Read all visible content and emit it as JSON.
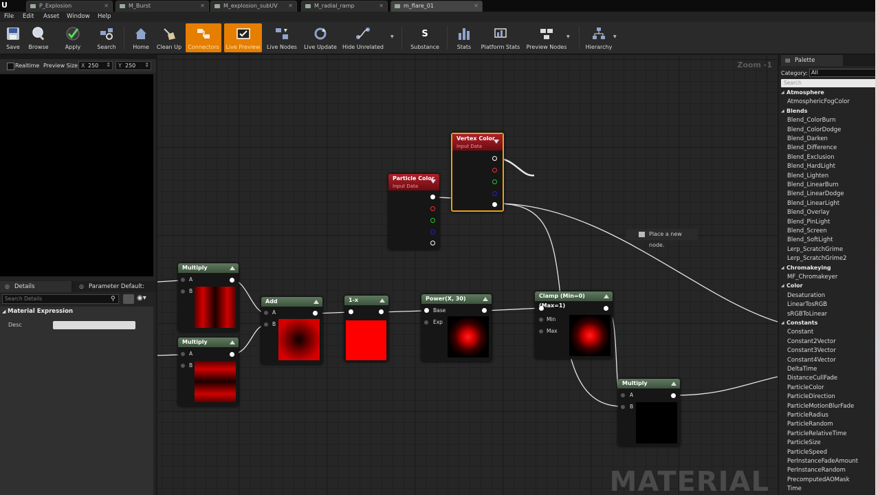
{
  "tabs": [
    {
      "label": "P_Explosion",
      "active": false
    },
    {
      "label": "M_Burst",
      "active": false
    },
    {
      "label": "M_explosion_subUV",
      "active": false
    },
    {
      "label": "M_radial_ramp",
      "active": false
    },
    {
      "label": "m_flare_01",
      "active": true
    }
  ],
  "menu": [
    "File",
    "Edit",
    "Asset",
    "Window",
    "Help"
  ],
  "toolbar": {
    "save": "Save",
    "browse": "Browse",
    "apply": "Apply",
    "search": "Search",
    "home": "Home",
    "cleanup": "Clean Up",
    "connectors": "Connectors",
    "live_preview": "Live Preview",
    "live_nodes": "Live Nodes",
    "live_update": "Live Update",
    "hide_unrelated": "Hide Unrelated",
    "substance": "Substance",
    "stats": "Stats",
    "platform_stats": "Platform Stats",
    "preview_nodes": "Preview Nodes",
    "hierarchy": "Hierarchy"
  },
  "preview": {
    "realtime": "Realtime",
    "preview_size": "Preview Size",
    "x_label": "X",
    "x_value": "250",
    "y_label": "Y",
    "y_value": "250"
  },
  "details": {
    "tab_details": "Details",
    "tab_params": "Parameter Default:",
    "search_placeholder": "Search Details",
    "section": "Material Expression",
    "desc_label": "Desc",
    "desc_value": ""
  },
  "graph": {
    "zoom": "Zoom -1",
    "watermark": "MATERIAL",
    "place_node": "Place a new node."
  },
  "nodes": {
    "vertex_color": {
      "title": "Vertex Color",
      "subtitle": "Input Data"
    },
    "particle_color": {
      "title": "Particle Color",
      "subtitle": "Input Data"
    },
    "multiply1": {
      "title": "Multiply",
      "a": "A",
      "b": "B"
    },
    "multiply2": {
      "title": "Multiply",
      "a": "A",
      "b": "B"
    },
    "add": {
      "title": "Add",
      "a": "A",
      "b": "B"
    },
    "one_minus": {
      "title": "1-x"
    },
    "power": {
      "title": "Power(X, 30)",
      "base": "Base",
      "exp": "Exp"
    },
    "clamp": {
      "title": "Clamp (Min=0) (Max=1)",
      "min": "Min",
      "max": "Max"
    },
    "multiply3": {
      "title": "Multiply",
      "a": "A",
      "b": "B"
    }
  },
  "palette": {
    "title": "Palette",
    "category_label": "Category:",
    "category_value": "All",
    "search_placeholder": "Search",
    "entries": [
      {
        "type": "cat",
        "text": "Atmosphere"
      },
      {
        "type": "item",
        "text": "AtmosphericFogColor"
      },
      {
        "type": "cat",
        "text": "Blends"
      },
      {
        "type": "item",
        "text": "Blend_ColorBurn"
      },
      {
        "type": "item",
        "text": "Blend_ColorDodge"
      },
      {
        "type": "item",
        "text": "Blend_Darken"
      },
      {
        "type": "item",
        "text": "Blend_Difference"
      },
      {
        "type": "item",
        "text": "Blend_Exclusion"
      },
      {
        "type": "item",
        "text": "Blend_HardLight"
      },
      {
        "type": "item",
        "text": "Blend_Lighten"
      },
      {
        "type": "item",
        "text": "Blend_LinearBurn"
      },
      {
        "type": "item",
        "text": "Blend_LinearDodge"
      },
      {
        "type": "item",
        "text": "Blend_LinearLight"
      },
      {
        "type": "item",
        "text": "Blend_Overlay"
      },
      {
        "type": "item",
        "text": "Blend_PinLight"
      },
      {
        "type": "item",
        "text": "Blend_Screen"
      },
      {
        "type": "item",
        "text": "Blend_SoftLight"
      },
      {
        "type": "item",
        "text": "Lerp_ScratchGrime"
      },
      {
        "type": "item",
        "text": "Lerp_ScratchGrime2"
      },
      {
        "type": "cat",
        "text": "Chromakeying"
      },
      {
        "type": "item",
        "text": "MF_Chromakeyer"
      },
      {
        "type": "cat",
        "text": "Color"
      },
      {
        "type": "item",
        "text": "Desaturation"
      },
      {
        "type": "item",
        "text": "LinearTosRGB"
      },
      {
        "type": "item",
        "text": "sRGBToLinear"
      },
      {
        "type": "cat",
        "text": "Constants"
      },
      {
        "type": "item",
        "text": "Constant"
      },
      {
        "type": "item",
        "text": "Constant2Vector"
      },
      {
        "type": "item",
        "text": "Constant3Vector"
      },
      {
        "type": "item",
        "text": "Constant4Vector"
      },
      {
        "type": "item",
        "text": "DeltaTime"
      },
      {
        "type": "item",
        "text": "DistanceCullFade"
      },
      {
        "type": "item",
        "text": "ParticleColor"
      },
      {
        "type": "item",
        "text": "ParticleDirection"
      },
      {
        "type": "item",
        "text": "ParticleMotionBlurFade"
      },
      {
        "type": "item",
        "text": "ParticleRadius"
      },
      {
        "type": "item",
        "text": "ParticleRandom"
      },
      {
        "type": "item",
        "text": "ParticleRelativeTime"
      },
      {
        "type": "item",
        "text": "ParticleSize"
      },
      {
        "type": "item",
        "text": "ParticleSpeed"
      },
      {
        "type": "item",
        "text": "PerInstanceFadeAmount"
      },
      {
        "type": "item",
        "text": "PerInstanceRandom"
      },
      {
        "type": "item",
        "text": "PrecomputedAOMask"
      },
      {
        "type": "item",
        "text": "Time"
      }
    ]
  }
}
